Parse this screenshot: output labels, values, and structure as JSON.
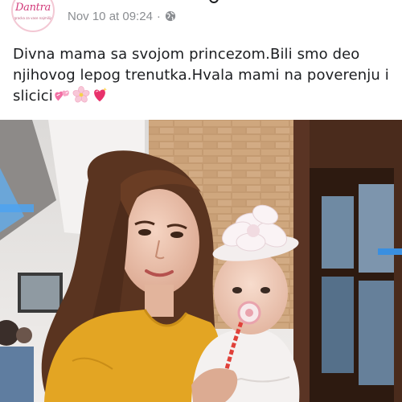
{
  "post": {
    "author_logo_text": "Dantra",
    "author_logo_sub": "igracka za vase najmilije",
    "timestamp": "Nov 10 at 09:24",
    "separator": "·",
    "privacy_icon": "globe-icon",
    "caption": "Divna mama sa svojom princezom.Bili smo deo njihovog lepog trenutka.Hvala mami na poverenju i slicici",
    "caption_emojis": [
      "two-hearts-icon",
      "cherry-blossom-icon",
      "sparkling-heart-icon"
    ]
  },
  "photo": {
    "subject": "photo",
    "colors": {
      "dress": "#e3a523",
      "hair": "#5a3420",
      "brick_wall": "#c9a27a",
      "window_frame": "#4a2b1c",
      "baby_outfit": "#f4f1f0",
      "pacifier_chain": "#e0413a"
    }
  }
}
